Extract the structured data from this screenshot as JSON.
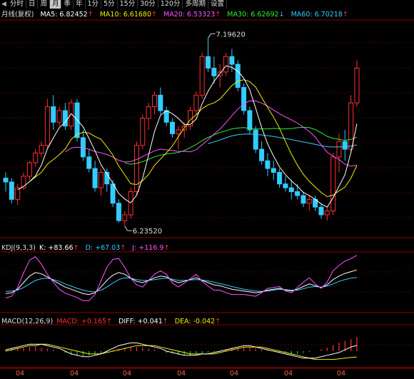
{
  "toolbar": {
    "items": [
      "分时",
      "日",
      "周",
      "月",
      "季",
      "年",
      "1分",
      "5分",
      "15分",
      "30分",
      "120分",
      "多周期",
      "设置"
    ],
    "active": "月"
  },
  "main_legend": {
    "title": "月线(复权)",
    "ma5_label": "MA5: 6.82452",
    "ma5_color": "#ffffff",
    "ma5_dir": "↑",
    "ma10_label": "MA10: 6.61680",
    "ma10_color": "#f0f000",
    "ma10_dir": "↑",
    "ma20_label": "MA20: 6.53323",
    "ma20_color": "#ff55ff",
    "ma20_dir": "↑",
    "ma30_label": "MA30: 6.62692",
    "ma30_color": "#33ee33",
    "ma30_dir": "↓",
    "ma60_label": "MA60: 6.70218",
    "ma60_color": "#33ccff",
    "ma60_dir": "↑"
  },
  "annotations": {
    "high_label": "7.19620",
    "low_label": "6.23520"
  },
  "kdj_legend": {
    "title": "KDJ(9,3,3)",
    "k_label": "K: +83.66",
    "k_dir": "↑",
    "k_color": "#ffffff",
    "d_label": "D: +67.03",
    "d_dir": "↑",
    "d_color": "#33ccff",
    "j_label": "J: +116.9",
    "j_dir": "↑",
    "j_color": "#ff55ff"
  },
  "macd_legend": {
    "title": "MACD(12,26,9)",
    "macd_label": "MACD: +0.165",
    "macd_dir": "↑",
    "macd_color": "#ff3030",
    "diff_label": "DIFF: +0.041",
    "diff_dir": "↑",
    "diff_color": "#ffffff",
    "dea_label": "DEA: -0.042",
    "dea_dir": "↑",
    "dea_color": "#f0f000"
  },
  "x_axis": {
    "labels": [
      "04",
      "04",
      "04",
      "04",
      "04",
      "04",
      "04"
    ]
  },
  "colors": {
    "up": "#ff3030",
    "down": "#33ccff",
    "grid": "#7a0000",
    "macd_neg": "#22cc22"
  },
  "chart_data": {
    "type": "candlestick",
    "candles": [
      [
        6.47,
        6.5,
        6.4,
        6.45
      ],
      [
        6.45,
        6.47,
        6.34,
        6.36
      ],
      [
        6.36,
        6.44,
        6.33,
        6.42
      ],
      [
        6.42,
        6.5,
        6.41,
        6.48
      ],
      [
        6.48,
        6.56,
        6.46,
        6.55
      ],
      [
        6.55,
        6.62,
        6.53,
        6.6
      ],
      [
        6.6,
        6.66,
        6.58,
        6.64
      ],
      [
        6.64,
        6.88,
        6.62,
        6.84
      ],
      [
        6.84,
        6.9,
        6.72,
        6.76
      ],
      [
        6.76,
        6.84,
        6.74,
        6.82
      ],
      [
        6.82,
        6.86,
        6.72,
        6.74
      ],
      [
        6.74,
        6.88,
        6.72,
        6.86
      ],
      [
        6.86,
        6.88,
        6.66,
        6.68
      ],
      [
        6.68,
        6.72,
        6.56,
        6.58
      ],
      [
        6.58,
        6.62,
        6.5,
        6.52
      ],
      [
        6.52,
        6.56,
        6.4,
        6.42
      ],
      [
        6.42,
        6.52,
        6.38,
        6.5
      ],
      [
        6.5,
        6.52,
        6.4,
        6.44
      ],
      [
        6.44,
        6.46,
        6.32,
        6.34
      ],
      [
        6.34,
        6.36,
        6.24,
        6.25
      ],
      [
        6.25,
        6.3,
        6.22,
        6.28
      ],
      [
        6.28,
        6.42,
        6.26,
        6.4
      ],
      [
        6.4,
        6.66,
        6.38,
        6.64
      ],
      [
        6.64,
        6.8,
        6.62,
        6.78
      ],
      [
        6.78,
        6.86,
        6.72,
        6.84
      ],
      [
        6.84,
        6.92,
        6.8,
        6.9
      ],
      [
        6.9,
        6.94,
        6.8,
        6.82
      ],
      [
        6.82,
        6.84,
        6.74,
        6.76
      ],
      [
        6.76,
        6.78,
        6.68,
        6.7
      ],
      [
        6.7,
        6.74,
        6.62,
        6.72
      ],
      [
        6.72,
        6.76,
        6.68,
        6.74
      ],
      [
        6.74,
        6.84,
        6.72,
        6.82
      ],
      [
        6.82,
        6.92,
        6.8,
        6.9
      ],
      [
        6.9,
        7.12,
        6.88,
        7.1
      ],
      [
        7.1,
        7.196,
        7.02,
        7.04
      ],
      [
        7.04,
        7.1,
        6.96,
        7.0
      ],
      [
        7.0,
        7.06,
        6.94,
        7.02
      ],
      [
        7.02,
        7.12,
        7.0,
        7.1
      ],
      [
        7.1,
        7.14,
        7.02,
        7.06
      ],
      [
        7.06,
        7.08,
        6.92,
        6.94
      ],
      [
        6.94,
        6.96,
        6.8,
        6.82
      ],
      [
        6.82,
        6.84,
        6.7,
        6.72
      ],
      [
        6.72,
        6.74,
        6.6,
        6.62
      ],
      [
        6.62,
        6.66,
        6.54,
        6.56
      ],
      [
        6.56,
        6.6,
        6.48,
        6.52
      ],
      [
        6.52,
        6.56,
        6.46,
        6.5
      ],
      [
        6.5,
        6.52,
        6.42,
        6.44
      ],
      [
        6.44,
        6.48,
        6.4,
        6.42
      ],
      [
        6.42,
        6.46,
        6.36,
        6.4
      ],
      [
        6.4,
        6.44,
        6.36,
        6.38
      ],
      [
        6.38,
        6.4,
        6.32,
        6.34
      ],
      [
        6.34,
        6.38,
        6.3,
        6.36
      ],
      [
        6.36,
        6.38,
        6.3,
        6.32
      ],
      [
        6.32,
        6.34,
        6.26,
        6.28
      ],
      [
        6.28,
        6.32,
        6.25,
        6.3
      ],
      [
        6.3,
        6.6,
        6.28,
        6.58
      ],
      [
        6.58,
        6.7,
        6.5,
        6.66
      ],
      [
        6.66,
        6.72,
        6.56,
        6.62
      ],
      [
        6.62,
        6.9,
        6.6,
        6.86
      ],
      [
        6.86,
        7.08,
        6.84,
        7.04
      ]
    ],
    "price_range": [
      6.18,
      7.26
    ],
    "kdj": {
      "K": [
        30,
        32,
        40,
        55,
        70,
        78,
        75,
        68,
        60,
        52,
        45,
        40,
        35,
        30,
        28,
        32,
        45,
        60,
        72,
        78,
        74,
        65,
        58,
        55,
        60,
        66,
        70,
        68,
        60,
        55,
        58,
        62,
        66,
        60,
        55,
        50,
        48,
        44,
        40,
        38,
        36,
        34,
        32,
        34,
        38,
        40,
        42,
        38,
        36,
        40,
        46,
        52,
        48,
        44,
        50,
        62,
        70,
        76,
        80,
        84
      ],
      "D": [
        35,
        36,
        38,
        44,
        52,
        60,
        64,
        65,
        62,
        58,
        52,
        47,
        42,
        38,
        35,
        34,
        38,
        45,
        54,
        62,
        66,
        65,
        62,
        60,
        60,
        62,
        64,
        65,
        63,
        60,
        60,
        61,
        62,
        61,
        59,
        56,
        53,
        50,
        46,
        43,
        40,
        38,
        36,
        35,
        36,
        38,
        40,
        39,
        38,
        38,
        41,
        45,
        46,
        45,
        47,
        52,
        58,
        62,
        65,
        67
      ],
      "J": [
        20,
        24,
        44,
        77,
        106,
        114,
        97,
        74,
        56,
        40,
        31,
        26,
        21,
        14,
        14,
        28,
        59,
        90,
        108,
        110,
        90,
        65,
        50,
        45,
        60,
        74,
        82,
        74,
        54,
        45,
        54,
        64,
        74,
        58,
        47,
        38,
        38,
        32,
        28,
        28,
        28,
        26,
        24,
        32,
        42,
        44,
        46,
        36,
        32,
        44,
        56,
        66,
        52,
        42,
        56,
        82,
        94,
        104,
        110,
        117
      ]
    },
    "macd": {
      "hist": [
        0.02,
        0.03,
        0.03,
        0.04,
        0.05,
        0.05,
        0.04,
        0.03,
        0.02,
        0.0,
        -0.02,
        -0.04,
        -0.05,
        -0.06,
        -0.05,
        -0.04,
        -0.03,
        -0.01,
        0.01,
        0.03,
        0.04,
        0.05,
        0.05,
        0.04,
        0.03,
        0.02,
        0.0,
        -0.02,
        -0.03,
        -0.04,
        -0.05,
        -0.05,
        -0.04,
        -0.03,
        -0.02,
        -0.01,
        0.0,
        0.02,
        0.03,
        0.04,
        0.05,
        0.04,
        0.03,
        0.02,
        0.01,
        0.0,
        -0.01,
        -0.02,
        -0.03,
        -0.03,
        -0.02,
        -0.01,
        0.0,
        0.02,
        0.04,
        0.07,
        0.1,
        0.12,
        0.14,
        0.165
      ],
      "diff": [
        0.01,
        0.02,
        0.03,
        0.04,
        0.05,
        0.05,
        0.05,
        0.04,
        0.03,
        0.02,
        0.0,
        -0.02,
        -0.03,
        -0.04,
        -0.04,
        -0.03,
        -0.02,
        0.0,
        0.02,
        0.04,
        0.05,
        0.06,
        0.06,
        0.05,
        0.04,
        0.03,
        0.02,
        0.0,
        -0.01,
        -0.02,
        -0.03,
        -0.03,
        -0.03,
        -0.02,
        -0.02,
        -0.01,
        0.0,
        0.01,
        0.02,
        0.03,
        0.04,
        0.04,
        0.03,
        0.02,
        0.01,
        0.0,
        -0.01,
        -0.02,
        -0.03,
        -0.04,
        -0.05,
        -0.05,
        -0.05,
        -0.04,
        -0.03,
        -0.02,
        -0.01,
        0.01,
        0.03,
        0.041
      ],
      "dea": [
        0.0,
        0.01,
        0.02,
        0.03,
        0.04,
        0.04,
        0.05,
        0.05,
        0.04,
        0.03,
        0.02,
        0.01,
        0.0,
        -0.01,
        -0.02,
        -0.02,
        -0.02,
        -0.01,
        0.0,
        0.01,
        0.02,
        0.03,
        0.04,
        0.04,
        0.04,
        0.04,
        0.03,
        0.02,
        0.01,
        0.0,
        -0.01,
        -0.02,
        -0.02,
        -0.02,
        -0.02,
        -0.02,
        -0.01,
        0.0,
        0.01,
        0.02,
        0.03,
        0.03,
        0.03,
        0.03,
        0.02,
        0.01,
        0.0,
        -0.01,
        -0.02,
        -0.03,
        -0.04,
        -0.05,
        -0.06,
        -0.06,
        -0.06,
        -0.06,
        -0.055,
        -0.05,
        -0.045,
        -0.042
      ]
    }
  }
}
